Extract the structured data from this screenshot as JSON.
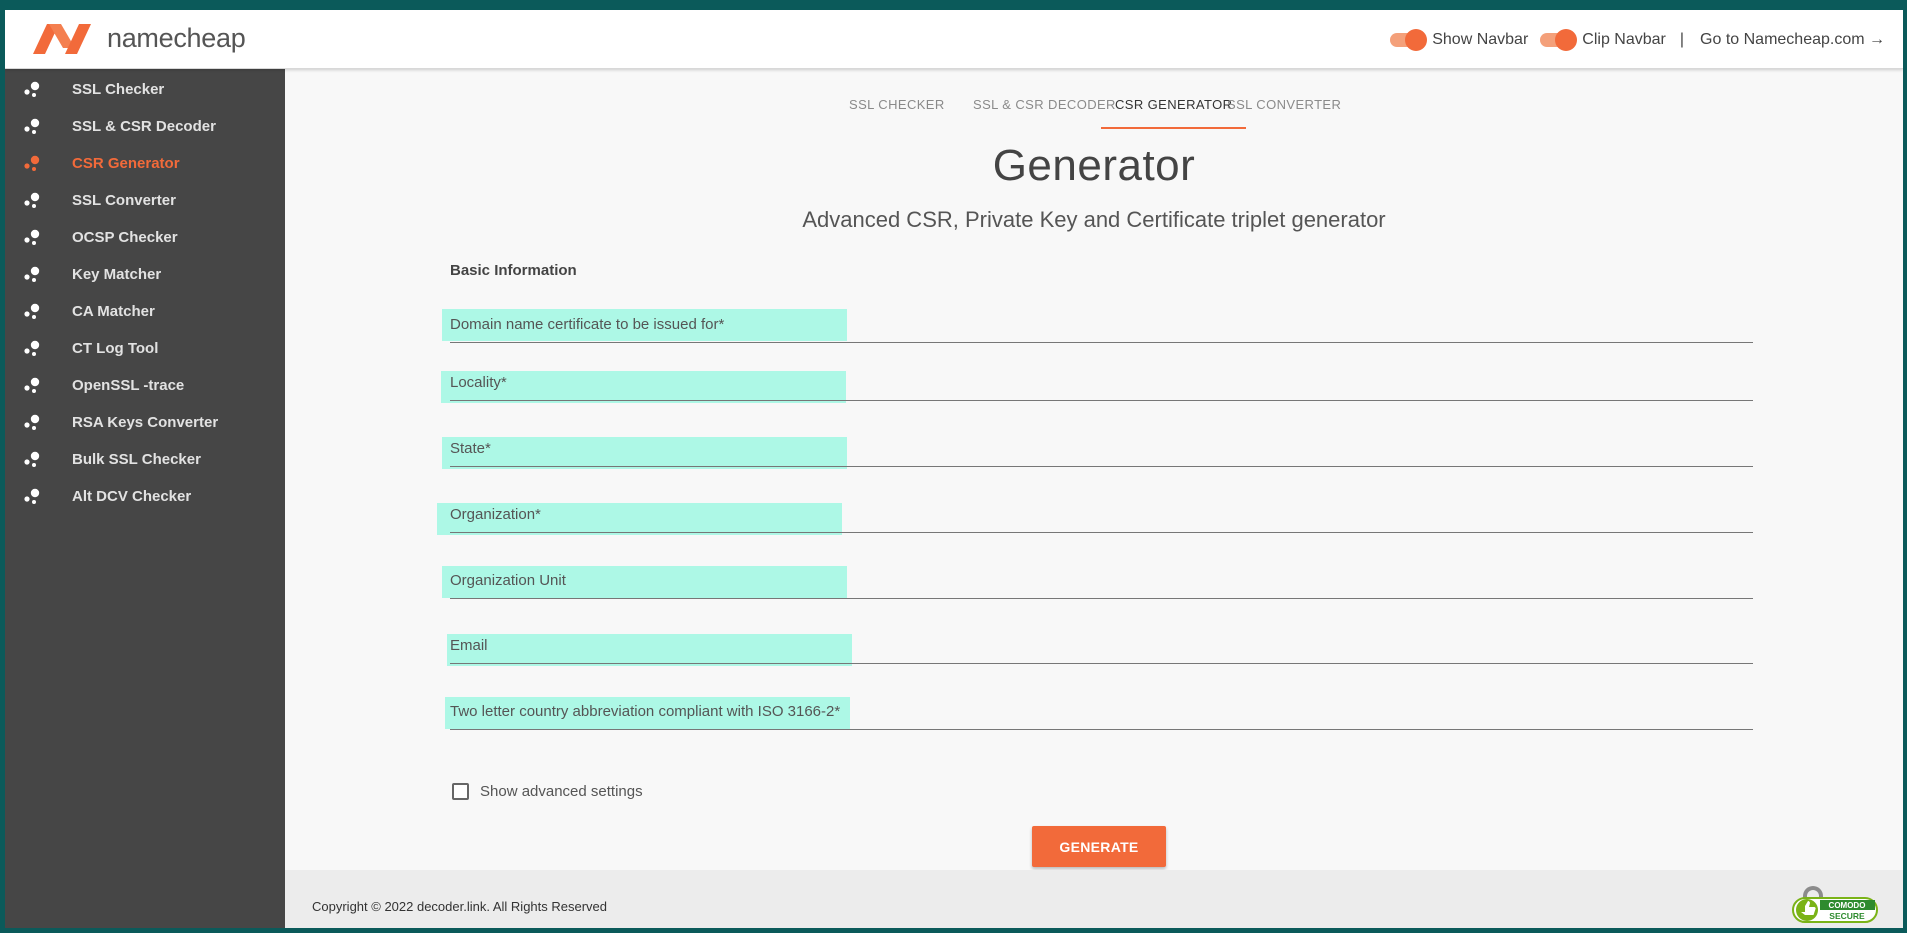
{
  "brand": {
    "name": "namecheap",
    "accent_color": "#f26a3a"
  },
  "header": {
    "show_navbar_label": "Show Navbar",
    "clip_navbar_label": "Clip Navbar",
    "separator": "|",
    "goto_label": "Go to Namecheap.com →"
  },
  "sidebar": {
    "items": [
      {
        "label": "SSL Checker",
        "active": false
      },
      {
        "label": "SSL & CSR Decoder",
        "active": false
      },
      {
        "label": "CSR Generator",
        "active": true
      },
      {
        "label": "SSL Converter",
        "active": false
      },
      {
        "label": "OCSP Checker",
        "active": false
      },
      {
        "label": "Key Matcher",
        "active": false
      },
      {
        "label": "CA Matcher",
        "active": false
      },
      {
        "label": "CT Log Tool",
        "active": false
      },
      {
        "label": "OpenSSL -trace",
        "active": false
      },
      {
        "label": "RSA Keys Converter",
        "active": false
      },
      {
        "label": "Bulk SSL Checker",
        "active": false
      },
      {
        "label": "Alt DCV Checker",
        "active": false
      }
    ]
  },
  "tabs": [
    {
      "label": "SSL CHECKER",
      "active": false
    },
    {
      "label": "SSL & CSR DECODER",
      "active": false
    },
    {
      "label": "CSR GENERATOR",
      "active": true
    },
    {
      "label": "SSL CONVERTER",
      "active": false
    }
  ],
  "main": {
    "title": "Generator",
    "subtitle": "Advanced CSR, Private Key and Certificate triplet generator",
    "section_label": "Basic Information",
    "fields": [
      {
        "placeholder": "Domain name certificate to be issued for*",
        "value": ""
      },
      {
        "placeholder": "Locality*",
        "value": ""
      },
      {
        "placeholder": "State*",
        "value": ""
      },
      {
        "placeholder": "Organization*",
        "value": ""
      },
      {
        "placeholder": "Organization Unit",
        "value": ""
      },
      {
        "placeholder": "Email",
        "value": ""
      },
      {
        "placeholder": "Two letter country abbreviation compliant with ISO 3166-2*",
        "value": ""
      }
    ],
    "advanced_label": "Show advanced settings",
    "advanced_checked": false,
    "generate_label": "GENERATE"
  },
  "footer": {
    "copyright": "Copyright © 2022 decoder.link. All Rights Reserved",
    "seal_top": "COMODO",
    "seal_bottom": "SECURE"
  }
}
